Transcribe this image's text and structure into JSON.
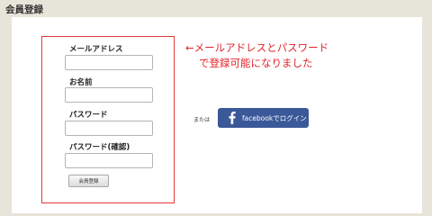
{
  "header": {
    "title": "会員登録"
  },
  "form": {
    "email_label": "メールアドレス",
    "email_value": "",
    "name_label": "お名前",
    "name_value": "",
    "password_label": "パスワード",
    "password_value": "",
    "password_confirm_label": "パスワード(確認)",
    "password_confirm_value": "",
    "submit_label": "会員登録"
  },
  "annotation": {
    "line1": "←メールアドレスとパスワード",
    "line2": "で登録可能になりました",
    "color": "#e2232a"
  },
  "social": {
    "or_text": "または",
    "facebook_label": "facebookでログイン",
    "facebook_color": "#3b5898",
    "facebook_icon": "facebook-f-icon"
  },
  "colors": {
    "background": "#e7e4da",
    "highlight_border": "#e23a3a"
  }
}
